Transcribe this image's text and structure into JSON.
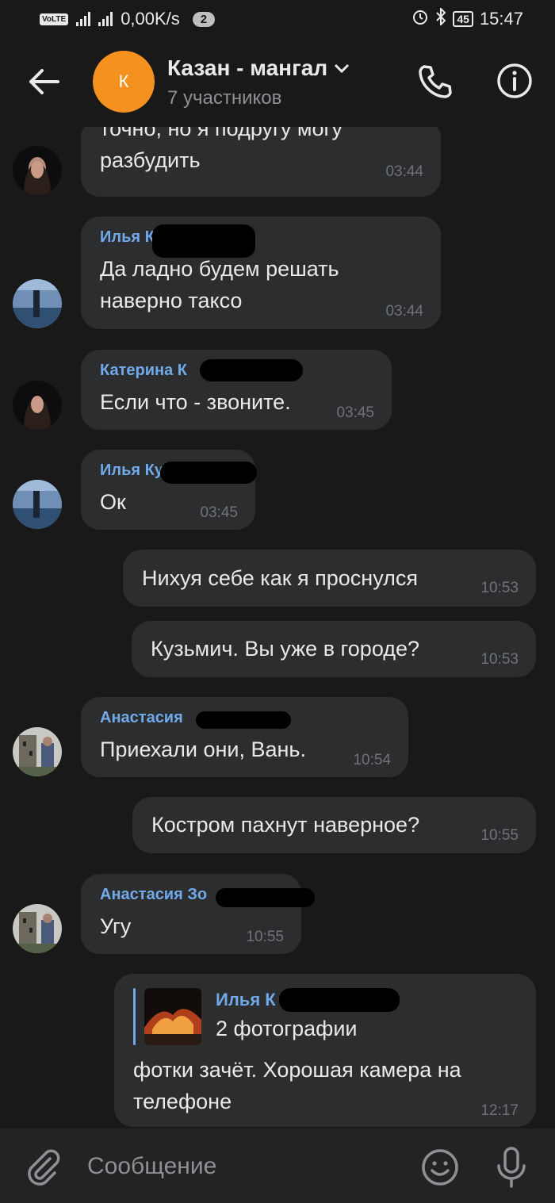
{
  "status_bar": {
    "volte": "VoLTE",
    "speed": "0,00K/s",
    "notif_count": "2",
    "battery": "45",
    "time": "15:47"
  },
  "header": {
    "avatar_letter": "К",
    "title": "Казан - мангал",
    "subtitle": "7 участников"
  },
  "messages": [
    {
      "author": "",
      "lines": [
        "точно, но я подругу могу",
        "разбудить"
      ],
      "time": "03:44"
    },
    {
      "author": "Илья К",
      "lines": [
        "Да ладно будем решать",
        "наверно таксо"
      ],
      "time": "03:44"
    },
    {
      "author": "Катерина К",
      "lines": [
        "Если что - звоните."
      ],
      "time": "03:45"
    },
    {
      "author": "Илья Ку",
      "lines": [
        "Ок"
      ],
      "time": "03:45"
    },
    {
      "author": "",
      "lines": [
        "Нихуя себе как я проснулся"
      ],
      "time": "10:53"
    },
    {
      "author": "",
      "lines": [
        "Кузьмич. Вы уже в городе?"
      ],
      "time": "10:53"
    },
    {
      "author": "Анастасия",
      "lines": [
        "Приехали они, Вань."
      ],
      "time": "10:54"
    },
    {
      "author": "",
      "lines": [
        "Костром пахнут наверное?"
      ],
      "time": "10:55"
    },
    {
      "author": "Анастасия Зо",
      "lines": [
        "Угу"
      ],
      "time": "10:55"
    },
    {
      "author": "",
      "lines": [
        "фотки зачёт. Хорошая камера на",
        "телефоне"
      ],
      "time": "12:17",
      "reply": {
        "author": "Илья К",
        "text": "2 фотографии"
      }
    }
  ],
  "composer": {
    "placeholder": "Сообщение"
  },
  "colors": {
    "accent": "#71aaeb",
    "bubble": "#2c2d2e",
    "background": "#19191a",
    "chat_avatar": "#f5911f"
  }
}
